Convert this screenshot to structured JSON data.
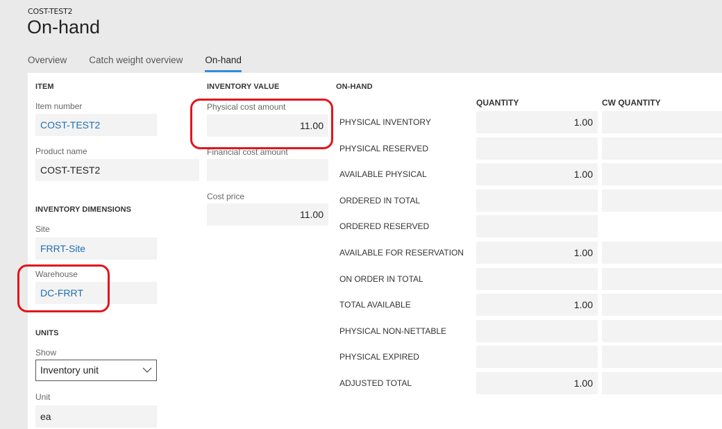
{
  "header": {
    "breadcrumb": "COST-TEST2",
    "title": "On-hand"
  },
  "tabs": [
    {
      "label": "Overview",
      "active": false
    },
    {
      "label": "Catch weight overview",
      "active": false
    },
    {
      "label": "On-hand",
      "active": true
    }
  ],
  "item": {
    "section_title": "ITEM",
    "item_number_label": "Item number",
    "item_number_value": "COST-TEST2",
    "product_name_label": "Product name",
    "product_name_value": "COST-TEST2"
  },
  "inventory_dimensions": {
    "section_title": "INVENTORY DIMENSIONS",
    "site_label": "Site",
    "site_value": "FRRT-Site",
    "warehouse_label": "Warehouse",
    "warehouse_value": "DC-FRRT"
  },
  "units": {
    "section_title": "UNITS",
    "show_label": "Show",
    "show_value": "Inventory unit",
    "unit_label": "Unit",
    "unit_value": "ea"
  },
  "inventory_value": {
    "section_title": "INVENTORY VALUE",
    "physical_cost_amount_label": "Physical cost amount",
    "physical_cost_amount_value": "11.00",
    "financial_cost_amount_label": "Financial cost amount",
    "financial_cost_amount_value": "",
    "cost_price_label": "Cost price",
    "cost_price_value": "11.00"
  },
  "on_hand": {
    "section_title": "ON-HAND",
    "columns": [
      "QUANTITY",
      "CW QUANTITY"
    ],
    "rows": [
      {
        "label": "PHYSICAL INVENTORY",
        "quantity": "1.00",
        "cw_quantity": "",
        "has_cw": true
      },
      {
        "label": "PHYSICAL RESERVED",
        "quantity": "",
        "cw_quantity": "",
        "has_cw": true
      },
      {
        "label": "AVAILABLE PHYSICAL",
        "quantity": "1.00",
        "cw_quantity": "",
        "has_cw": true
      },
      {
        "label": "ORDERED IN TOTAL",
        "quantity": "",
        "cw_quantity": "",
        "has_cw": true
      },
      {
        "label": "ORDERED RESERVED",
        "quantity": "",
        "cw_quantity": "",
        "has_cw": false
      },
      {
        "label": "AVAILABLE FOR RESERVATION",
        "quantity": "1.00",
        "cw_quantity": "",
        "has_cw": true
      },
      {
        "label": "ON ORDER IN TOTAL",
        "quantity": "",
        "cw_quantity": "",
        "has_cw": true
      },
      {
        "label": "TOTAL AVAILABLE",
        "quantity": "1.00",
        "cw_quantity": "",
        "has_cw": true
      },
      {
        "label": "PHYSICAL NON-NETTABLE",
        "quantity": "",
        "cw_quantity": "",
        "has_cw": true
      },
      {
        "label": "PHYSICAL EXPIRED",
        "quantity": "",
        "cw_quantity": "",
        "has_cw": true
      },
      {
        "label": "ADJUSTED TOTAL",
        "quantity": "1.00",
        "cw_quantity": "",
        "has_cw": true
      }
    ]
  },
  "annotations": {
    "highlight_color": "#e3141b"
  }
}
